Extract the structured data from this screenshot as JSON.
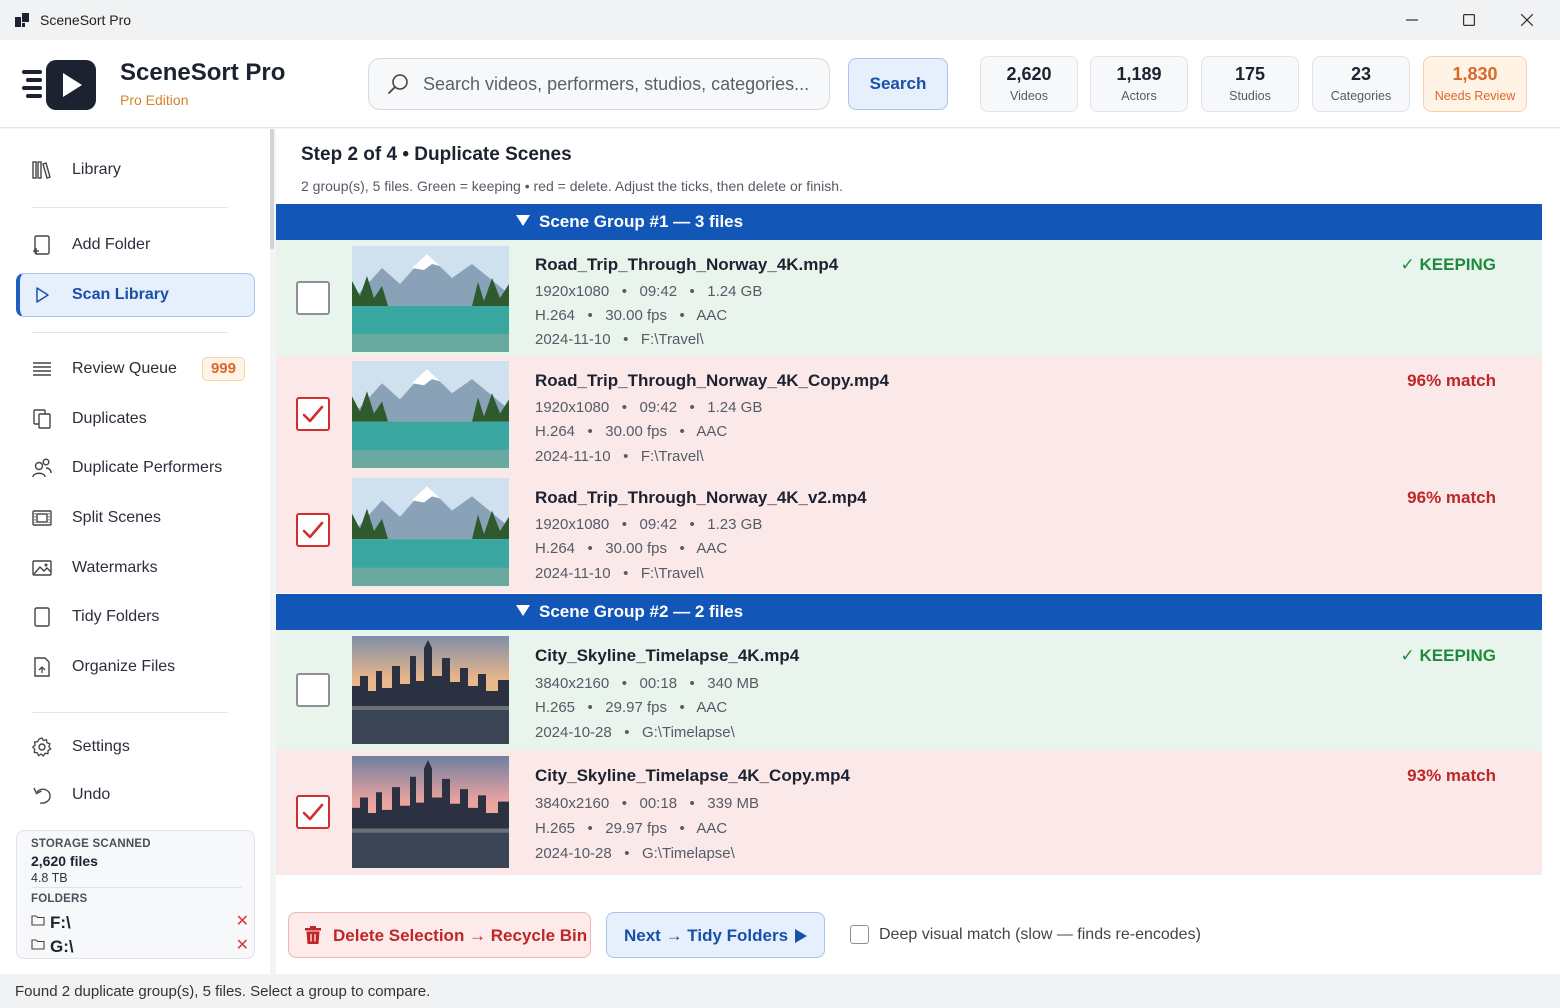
{
  "window": {
    "title": "SceneSort Pro"
  },
  "header": {
    "app_name": "SceneSort Pro",
    "edition": "Pro Edition",
    "search_placeholder": "Search videos, performers, studios, categories...",
    "search_button": "Search",
    "stats": [
      {
        "value": "2,620",
        "label": "Videos"
      },
      {
        "value": "1,189",
        "label": "Actors"
      },
      {
        "value": "175",
        "label": "Studios"
      },
      {
        "value": "23",
        "label": "Categories"
      },
      {
        "value": "1,830",
        "label": "Needs Review"
      }
    ]
  },
  "sidebar": {
    "items": [
      {
        "label": "Library",
        "icon": "library-icon"
      },
      {
        "label": "Add Folder",
        "icon": "add-folder-icon"
      },
      {
        "label": "Scan Library",
        "icon": "play-icon",
        "active": true
      },
      {
        "label": "Review Queue",
        "icon": "list-icon",
        "badge": "999"
      },
      {
        "label": "Duplicates",
        "icon": "copy-icon"
      },
      {
        "label": "Duplicate Performers",
        "icon": "people-icon"
      },
      {
        "label": "Split Scenes",
        "icon": "film-icon"
      },
      {
        "label": "Watermarks",
        "icon": "image-icon"
      },
      {
        "label": "Tidy Folders",
        "icon": "file-icon"
      },
      {
        "label": "Organize Files",
        "icon": "organize-icon"
      },
      {
        "label": "Settings",
        "icon": "gear-icon"
      },
      {
        "label": "Undo",
        "icon": "undo-icon"
      }
    ],
    "storage": {
      "caption": "STORAGE SCANNED",
      "files": "2,620 files",
      "size": "4.8 TB",
      "folders_caption": "FOLDERS",
      "folders": [
        "F:\\",
        "G:\\"
      ]
    }
  },
  "main": {
    "step_title": "Step 2 of 4  •  Duplicate Scenes",
    "step_sub": "2 group(s), 5 files. Green = keeping • red = delete. Adjust the ticks, then delete or finish.",
    "groups": [
      {
        "title": "Scene Group #1  —  3 files",
        "files": [
          {
            "name": "Road_Trip_Through_Norway_4K.mp4",
            "meta1": "1920x1080   •   09:42   •   1.24 GB",
            "meta2": "H.264   •   30.00 fps   •   AAC",
            "meta3": "2024-11-10   •   F:\\Travel\\",
            "status": "✓ KEEPING"
          },
          {
            "name": "Road_Trip_Through_Norway_4K_Copy.mp4",
            "meta1": "1920x1080   •   09:42   •   1.24 GB",
            "meta2": "H.264   •   30.00 fps   •   AAC",
            "meta3": "2024-11-10   •   F:\\Travel\\",
            "status": "96% match"
          },
          {
            "name": "Road_Trip_Through_Norway_4K_v2.mp4",
            "meta1": "1920x1080   •   09:42   •   1.23 GB",
            "meta2": "H.264   •   30.00 fps   •   AAC",
            "meta3": "2024-11-10   •   F:\\Travel\\",
            "status": "96% match"
          }
        ]
      },
      {
        "title": "Scene Group #2  —  2 files",
        "files": [
          {
            "name": "City_Skyline_Timelapse_4K.mp4",
            "meta1": "3840x2160   •   00:18   •   340 MB",
            "meta2": "H.265   •   29.97 fps   •   AAC",
            "meta3": "2024-10-28   •   G:\\Timelapse\\",
            "status": "✓ KEEPING"
          },
          {
            "name": "City_Skyline_Timelapse_4K_Copy.mp4",
            "meta1": "3840x2160   •   00:18   •   339 MB",
            "meta2": "H.265   •   29.97 fps   •   AAC",
            "meta3": "2024-10-28   •   G:\\Timelapse\\",
            "status": "93% match"
          }
        ]
      }
    ],
    "delete_button": "Delete Selection → Recycle Bin",
    "next_button": "Next → Tidy Folders",
    "deep_match_label": "Deep visual match (slow — finds re-encodes)"
  },
  "statusbar": {
    "text": "Found 2 duplicate group(s), 5 files. Select a group to compare."
  },
  "colors": {
    "accent": "#1257b8",
    "keep_bg": "#e9f5ec",
    "delete_bg": "#fbe9ea",
    "warning": "#d9682b"
  }
}
